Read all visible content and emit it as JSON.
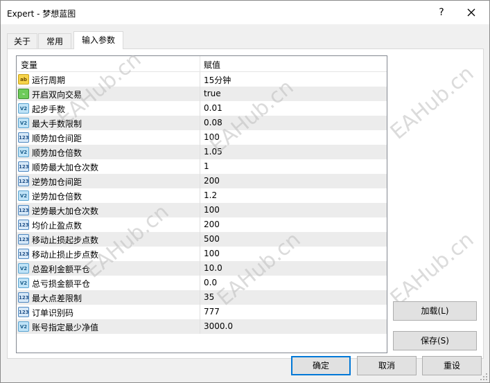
{
  "window": {
    "title": "Expert - 梦想蓝图",
    "help_label": "?",
    "close_icon": "close-icon"
  },
  "tabs": [
    {
      "label": "关于",
      "active": false
    },
    {
      "label": "常用",
      "active": false
    },
    {
      "label": "输入参数",
      "active": true
    }
  ],
  "grid": {
    "columns": [
      "变量",
      "赋值"
    ],
    "rows": [
      {
        "name": "运行周期",
        "value": "15分钟",
        "icon": "ab",
        "type": "string"
      },
      {
        "name": "开启双向交易",
        "value": "true",
        "icon": "bool",
        "type": "bool"
      },
      {
        "name": "起步手数",
        "value": "0.01",
        "icon": "v2",
        "type": "double"
      },
      {
        "name": "最大手数限制",
        "value": "0.08",
        "icon": "v2",
        "type": "double"
      },
      {
        "name": "顺势加仓间距",
        "value": "100",
        "icon": "123",
        "type": "int"
      },
      {
        "name": "顺势加仓倍数",
        "value": "1.05",
        "icon": "v2",
        "type": "double"
      },
      {
        "name": "顺势最大加仓次数",
        "value": "1",
        "icon": "123",
        "type": "int"
      },
      {
        "name": "逆势加仓间距",
        "value": "200",
        "icon": "123",
        "type": "int"
      },
      {
        "name": "逆势加仓倍数",
        "value": "1.2",
        "icon": "v2",
        "type": "double"
      },
      {
        "name": "逆势最大加仓次数",
        "value": "100",
        "icon": "123",
        "type": "int"
      },
      {
        "name": "均价止盈点数",
        "value": "200",
        "icon": "123",
        "type": "int"
      },
      {
        "name": "移动止损起步点数",
        "value": "500",
        "icon": "123",
        "type": "int"
      },
      {
        "name": "移动止损止步点数",
        "value": "100",
        "icon": "123",
        "type": "int"
      },
      {
        "name": "总盈利金额平仓",
        "value": "10.0",
        "icon": "v2",
        "type": "double"
      },
      {
        "name": "总亏损金额平仓",
        "value": "0.0",
        "icon": "v2",
        "type": "double"
      },
      {
        "name": "最大点差限制",
        "value": "35",
        "icon": "123",
        "type": "int"
      },
      {
        "name": "订单识别码",
        "value": "777",
        "icon": "123",
        "type": "int"
      },
      {
        "name": "账号指定最少净值",
        "value": "3000.0",
        "icon": "v2",
        "type": "double"
      }
    ]
  },
  "buttons": {
    "load": "加载(L)",
    "save": "保存(S)",
    "ok": "确定",
    "cancel": "取消",
    "reset": "重设"
  },
  "watermark": "EAHub.cn",
  "colors": {
    "accent": "#0078d7",
    "alt_row": "#ececec",
    "icon_string": "#f6d34a",
    "icon_bool": "#6ecb5a",
    "icon_double": "#bfe3f7",
    "icon_int": "#d6e8f8"
  }
}
